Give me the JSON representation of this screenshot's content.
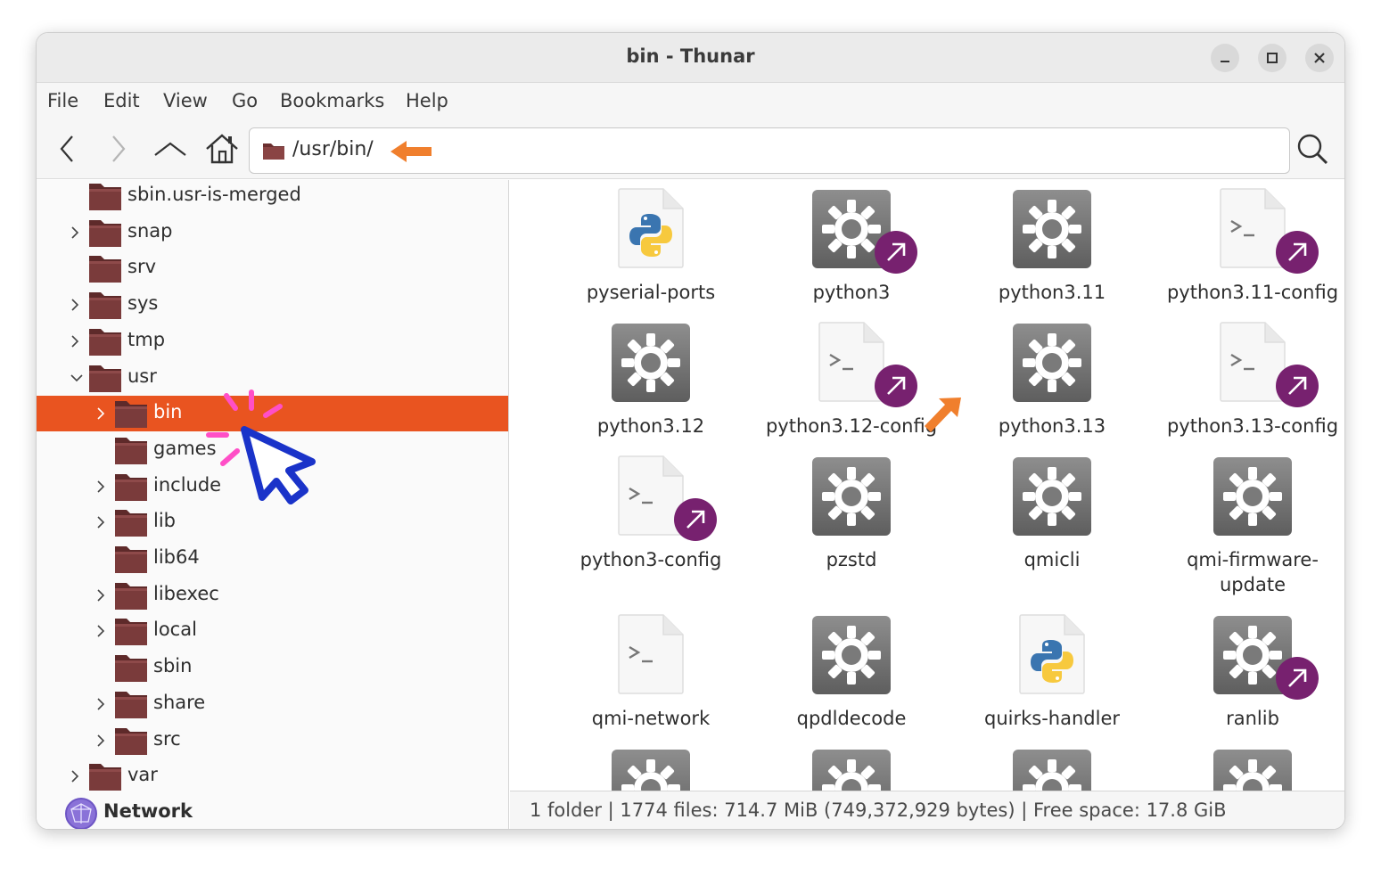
{
  "window": {
    "title": "bin - Thunar"
  },
  "menu": [
    "File",
    "Edit",
    "View",
    "Go",
    "Bookmarks",
    "Help"
  ],
  "location": {
    "path": "/usr/bin/"
  },
  "colors": {
    "selection": "#e95420",
    "symlink_badge": "#77216f",
    "folder": "#7a3b3b",
    "annotation_arrow": "#f07f2d",
    "cursor": "#1a33c9"
  },
  "tree": [
    {
      "label": "sbin.usr-is-merged",
      "expander": "none",
      "depth": 1
    },
    {
      "label": "snap",
      "expander": "collapsed",
      "depth": 1
    },
    {
      "label": "srv",
      "expander": "none",
      "depth": 1
    },
    {
      "label": "sys",
      "expander": "collapsed",
      "depth": 1
    },
    {
      "label": "tmp",
      "expander": "collapsed",
      "depth": 1
    },
    {
      "label": "usr",
      "expander": "expanded",
      "depth": 1
    },
    {
      "label": "bin",
      "expander": "collapsed",
      "depth": 2,
      "selected": true
    },
    {
      "label": "games",
      "expander": "none",
      "depth": 2
    },
    {
      "label": "include",
      "expander": "collapsed",
      "depth": 2
    },
    {
      "label": "lib",
      "expander": "collapsed",
      "depth": 2
    },
    {
      "label": "lib64",
      "expander": "none",
      "depth": 2
    },
    {
      "label": "libexec",
      "expander": "collapsed",
      "depth": 2
    },
    {
      "label": "local",
      "expander": "collapsed",
      "depth": 2
    },
    {
      "label": "sbin",
      "expander": "none",
      "depth": 2
    },
    {
      "label": "share",
      "expander": "collapsed",
      "depth": 2
    },
    {
      "label": "src",
      "expander": "collapsed",
      "depth": 2
    },
    {
      "label": "var",
      "expander": "collapsed",
      "depth": 1
    }
  ],
  "network": {
    "label": "Network"
  },
  "files": [
    {
      "name": "pyserial-ports",
      "icon": "python-script",
      "symlink": false
    },
    {
      "name": "python3",
      "icon": "gear-executable",
      "symlink": true
    },
    {
      "name": "python3.11",
      "icon": "gear-executable",
      "symlink": false
    },
    {
      "name": "python3.11-config",
      "icon": "terminal-script",
      "symlink": true
    },
    {
      "name": "python3.12",
      "icon": "gear-executable",
      "symlink": false
    },
    {
      "name": "python3.12-config",
      "icon": "terminal-script",
      "symlink": true
    },
    {
      "name": "python3.13",
      "icon": "gear-executable",
      "symlink": false
    },
    {
      "name": "python3.13-config",
      "icon": "terminal-script",
      "symlink": true
    },
    {
      "name": "python3-config",
      "icon": "terminal-script",
      "symlink": true
    },
    {
      "name": "pzstd",
      "icon": "gear-executable",
      "symlink": false
    },
    {
      "name": "qmicli",
      "icon": "gear-executable",
      "symlink": false
    },
    {
      "name": "qmi-firmware-update",
      "icon": "gear-executable",
      "symlink": false
    },
    {
      "name": "qmi-network",
      "icon": "terminal-script",
      "symlink": false
    },
    {
      "name": "qpdldecode",
      "icon": "gear-executable",
      "symlink": false
    },
    {
      "name": "quirks-handler",
      "icon": "python-script",
      "symlink": false
    },
    {
      "name": "ranlib",
      "icon": "gear-executable",
      "symlink": true
    },
    {
      "name": "",
      "icon": "gear-executable",
      "symlink": true
    },
    {
      "name": "",
      "icon": "gear-executable",
      "symlink": false
    },
    {
      "name": "",
      "icon": "gear-executable",
      "symlink": false
    },
    {
      "name": "",
      "icon": "gear-executable",
      "symlink": true
    }
  ],
  "status": {
    "text": "1 folder  |  1774 files: 714.7 MiB (749,372,929 bytes)  |  Free space: 17.8 GiB"
  }
}
